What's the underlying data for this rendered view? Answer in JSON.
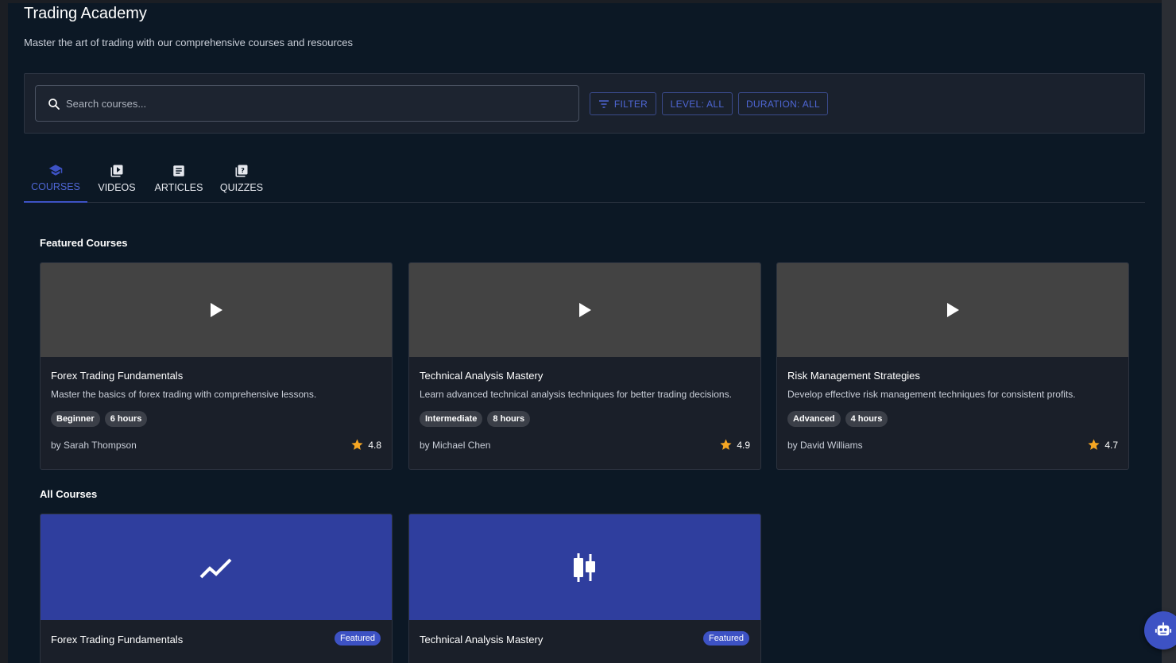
{
  "header": {
    "title": "Trading Academy",
    "subtitle": "Master the art of trading with our comprehensive courses and resources"
  },
  "search": {
    "placeholder": "Search courses...",
    "value": ""
  },
  "filters": {
    "filter_label": "FILTER",
    "level_label": "LEVEL: ALL",
    "duration_label": "DURATION: ALL"
  },
  "tabs": [
    {
      "label": "COURSES",
      "icon": "school-icon",
      "active": true
    },
    {
      "label": "VIDEOS",
      "icon": "video-library-icon",
      "active": false
    },
    {
      "label": "ARTICLES",
      "icon": "article-icon",
      "active": false
    },
    {
      "label": "QUIZZES",
      "icon": "quiz-icon",
      "active": false
    }
  ],
  "featured": {
    "title": "Featured Courses",
    "courses": [
      {
        "title": "Forex Trading Fundamentals",
        "description": "Master the basics of forex trading with comprehensive lessons.",
        "level": "Beginner",
        "duration": "6 hours",
        "author": "by Sarah Thompson",
        "rating": "4.8"
      },
      {
        "title": "Technical Analysis Mastery",
        "description": "Learn advanced technical analysis techniques for better trading decisions.",
        "level": "Intermediate",
        "duration": "8 hours",
        "author": "by Michael Chen",
        "rating": "4.9"
      },
      {
        "title": "Risk Management Strategies",
        "description": "Develop effective risk management techniques for consistent profits.",
        "level": "Advanced",
        "duration": "4 hours",
        "author": "by David Williams",
        "rating": "4.7"
      }
    ]
  },
  "all_courses": {
    "title": "All Courses",
    "courses": [
      {
        "title": "Forex Trading Fundamentals",
        "badge": "Featured",
        "icon": "trending-line-icon"
      },
      {
        "title": "Technical Analysis Mastery",
        "badge": "Featured",
        "icon": "candlestick-icon"
      }
    ]
  },
  "colors": {
    "accent": "#3d52c4",
    "background": "#0c1825",
    "card": "#1a1f29",
    "media_gray": "#434343",
    "media_blue": "#2f3e9e",
    "star": "#f5a623"
  }
}
